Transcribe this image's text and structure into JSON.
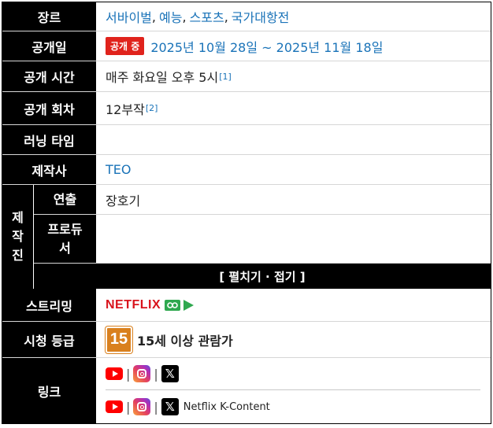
{
  "genre": {
    "label": "장르",
    "items": [
      "서바이벌",
      "예능",
      "스포츠",
      "국가대항전"
    ],
    "sep": ","
  },
  "release": {
    "label": "공개일",
    "badge": "공개 중",
    "dates": "2025년 10월 28일 ~ 2025년 11월 18일"
  },
  "time": {
    "label": "공개 시간",
    "value": "매주 화요일 오후 5시",
    "ref": "[1]"
  },
  "episodes": {
    "label": "공개 회차",
    "value": "12부작",
    "ref": "[2]"
  },
  "runtime": {
    "label": "러닝 타임",
    "value": ""
  },
  "producer": {
    "label": "제작사",
    "value": "TEO"
  },
  "staff": {
    "group_chars": [
      "제",
      "작",
      "진"
    ],
    "director": {
      "label": "연출",
      "value": "장호기"
    },
    "producer_label_1": "프로듀",
    "producer_label_2": "서",
    "producer_value": ""
  },
  "toggle": {
    "label": "[ 펼치기 · 접기 ]"
  },
  "streaming": {
    "label": "스트리밍",
    "service": "NETFLIX"
  },
  "rating": {
    "label": "시청 등급",
    "badge": "15",
    "text": "15세 이상 관람가"
  },
  "links": {
    "label": "링크",
    "bar": "|",
    "x_glyph": "𝕏",
    "netflix_kcontent": "Netflix K-Content"
  },
  "colors": {
    "link_blue": "#1a73b8",
    "badge_red": "#e0231c",
    "netflix_red": "#d9141d",
    "green": "#2fa84f",
    "rating_orange": "#d9801e"
  }
}
